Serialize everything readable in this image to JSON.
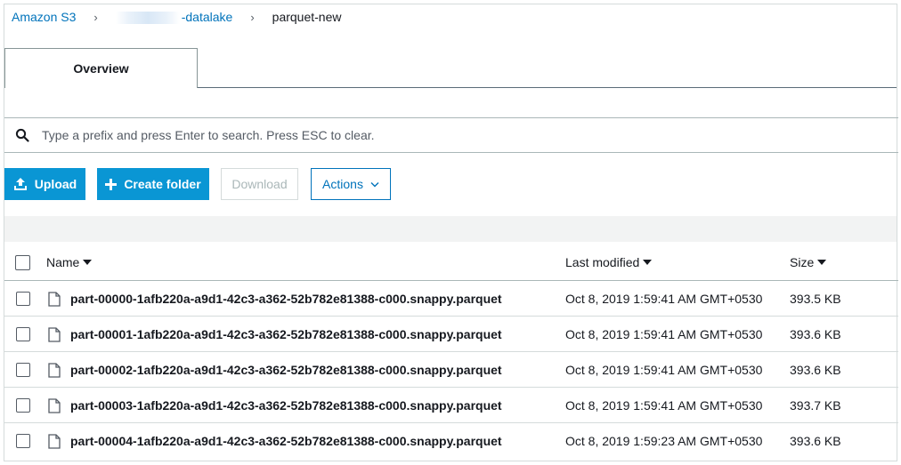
{
  "breadcrumb": {
    "root": "Amazon S3",
    "bucket": "-datalake",
    "folder": "parquet-new",
    "separator": "›"
  },
  "tabs": [
    {
      "label": "Overview",
      "active": true
    }
  ],
  "search": {
    "placeholder": "Type a prefix and press Enter to search. Press ESC to clear.",
    "value": ""
  },
  "toolbar": {
    "upload_label": "Upload",
    "create_folder_label": "Create folder",
    "download_label": "Download",
    "actions_label": "Actions"
  },
  "table": {
    "columns": [
      "Name",
      "Last modified",
      "Size"
    ],
    "rows": [
      {
        "name": "part-00000-1afb220a-a9d1-42c3-a362-52b782e81388-c000.snappy.parquet",
        "modified": "Oct 8, 2019 1:59:41 AM GMT+0530",
        "size": "393.5 KB"
      },
      {
        "name": "part-00001-1afb220a-a9d1-42c3-a362-52b782e81388-c000.snappy.parquet",
        "modified": "Oct 8, 2019 1:59:41 AM GMT+0530",
        "size": "393.6 KB"
      },
      {
        "name": "part-00002-1afb220a-a9d1-42c3-a362-52b782e81388-c000.snappy.parquet",
        "modified": "Oct 8, 2019 1:59:41 AM GMT+0530",
        "size": "393.6 KB"
      },
      {
        "name": "part-00003-1afb220a-a9d1-42c3-a362-52b782e81388-c000.snappy.parquet",
        "modified": "Oct 8, 2019 1:59:41 AM GMT+0530",
        "size": "393.7 KB"
      },
      {
        "name": "part-00004-1afb220a-a9d1-42c3-a362-52b782e81388-c000.snappy.parquet",
        "modified": "Oct 8, 2019 1:59:23 AM GMT+0530",
        "size": "393.6 KB"
      }
    ]
  },
  "colors": {
    "link": "#0073bb",
    "primary_button": "#0a96d4",
    "text": "#16191f"
  },
  "icons": [
    "search-icon",
    "upload-icon",
    "plus-icon",
    "chevron-down-icon",
    "sort-caret-icon",
    "file-icon"
  ]
}
